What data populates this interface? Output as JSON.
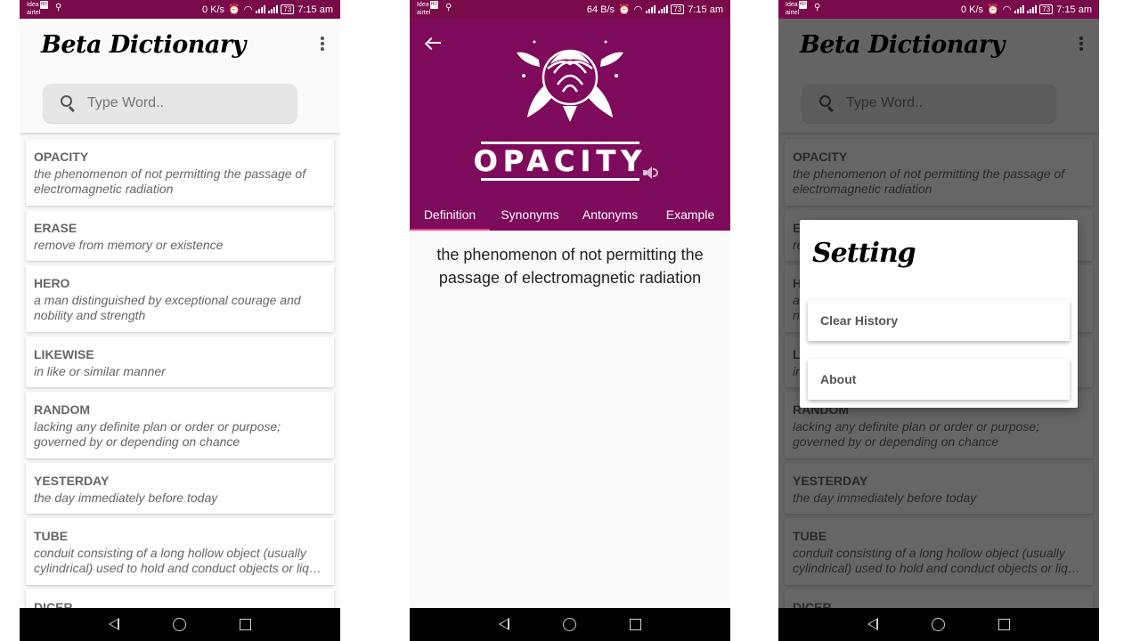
{
  "status_bars": [
    {
      "carrier": "Idea",
      "carrier2": "airtel",
      "hd": "HD",
      "speed": "0 K/s",
      "battery": "73",
      "time": "7:15 am"
    },
    {
      "carrier": "Idea",
      "carrier2": "airtel",
      "hd": "HD",
      "speed": "64 B/s",
      "battery": "73",
      "time": "7:15 am"
    },
    {
      "carrier": "Idea",
      "carrier2": "airtel",
      "hd": "HD",
      "speed": "0 K/s",
      "battery": "73",
      "time": "7:15 am"
    }
  ],
  "home": {
    "app_title": "Beta Dictionary",
    "search_placeholder": "Type Word..",
    "words": [
      {
        "word": "OPACITY",
        "definition": "the phenomenon of not permitting the passage of electromagnetic radiation"
      },
      {
        "word": "ERASE",
        "definition": "remove from memory or existence"
      },
      {
        "word": "HERO",
        "definition": "a man distinguished by exceptional courage and nobility and strength"
      },
      {
        "word": "LIKEWISE",
        "definition": "in like or similar manner"
      },
      {
        "word": "RANDOM",
        "definition": "lacking any definite plan or order or purpose; governed by or depending on chance"
      },
      {
        "word": "YESTERDAY",
        "definition": "the day immediately before today"
      },
      {
        "word": "TUBE",
        "definition": "conduit consisting of a long hollow object (usually cylindrical) used to hold and conduct objects or liq…"
      },
      {
        "word": "DICER",
        "definition": ""
      }
    ]
  },
  "detail": {
    "word": "OPACITY",
    "tabs": [
      "Definition",
      "Synonyms",
      "Antonyms",
      "Example"
    ],
    "active_tab": "Definition",
    "definition": "the phenomenon of not permitting the passage of electromagnetic radiation"
  },
  "settings_dialog": {
    "title": "Setting",
    "buttons": [
      "Clear History",
      "About"
    ]
  },
  "colors": {
    "status_bar": "#7a0b4b",
    "header_purple": "#7d0a5a",
    "tab_indicator": "#ff4081"
  }
}
